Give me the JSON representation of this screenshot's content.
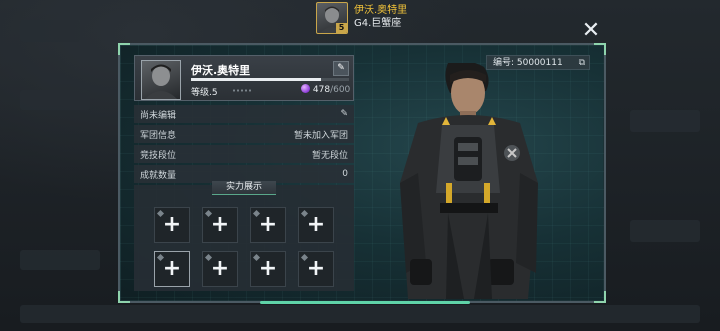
{
  "top": {
    "player_name": "伊沃.奥特里",
    "level_badge": "5",
    "rank": "G4.巨蟹座"
  },
  "close_label": "✕",
  "panel": {
    "id_label": "编号: 50000111",
    "copy_icon": "⧉"
  },
  "profile": {
    "name": "伊沃.奥特里",
    "edit_icon": "✎",
    "level_text": "等级.5",
    "exp_progress": 0.82,
    "gem_current": "478",
    "gem_max": "/600"
  },
  "rows": [
    {
      "label": "尚未编辑",
      "value": "✎"
    },
    {
      "label": "军团信息",
      "value": "暂未加入军团"
    },
    {
      "label": "竞技段位",
      "value": "暂无段位"
    },
    {
      "label": "成就数量",
      "value": "0"
    }
  ],
  "showcase": {
    "title": "实力展示",
    "slot_icon": "+"
  },
  "colors": {
    "accent_gold": "#f0c23a",
    "panel_border": "#4b5a63",
    "accent_green": "#5fd3a8",
    "gem_purple": "#8a3bd6"
  }
}
